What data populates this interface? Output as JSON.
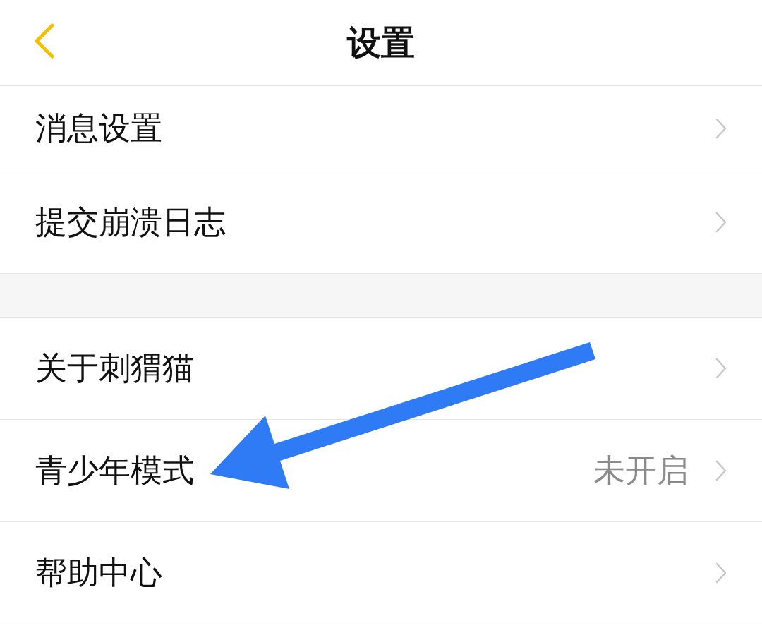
{
  "header": {
    "title": "设置"
  },
  "groups": [
    {
      "items": [
        {
          "label": "消息设置"
        },
        {
          "label": "提交崩溃日志"
        }
      ]
    },
    {
      "items": [
        {
          "label": "关于刺猬猫"
        },
        {
          "label": "青少年模式",
          "value": "未开启"
        },
        {
          "label": "帮助中心"
        }
      ]
    }
  ]
}
